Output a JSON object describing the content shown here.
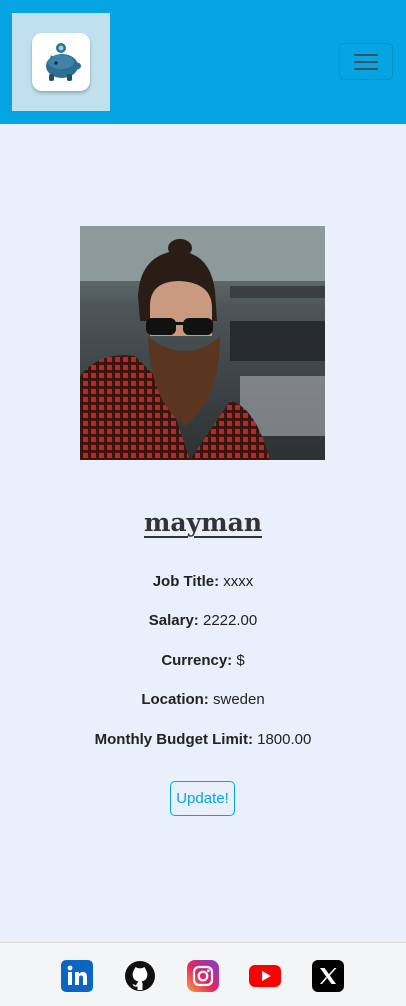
{
  "header": {
    "logo_icon": "piggy-bank-icon",
    "menu_icon": "hamburger-menu-icon"
  },
  "profile": {
    "photo_icon": "profile-photo",
    "username": "mayman",
    "fields": [
      {
        "label": "Job Title:",
        "value": "xxxx"
      },
      {
        "label": "Salary:",
        "value": "2222.00"
      },
      {
        "label": "Currency:",
        "value": "$"
      },
      {
        "label": "Location:",
        "value": "sweden"
      },
      {
        "label": "Monthly Budget Limit:",
        "value": "1800.00"
      }
    ],
    "update_label": "Update!"
  },
  "footer": {
    "social": [
      "linkedin-icon",
      "github-icon",
      "instagram-icon",
      "youtube-icon",
      "x-icon"
    ]
  },
  "colors": {
    "navbar": "#05a5e3",
    "page_background": "#e9f0fb",
    "accent": "#05a5e3",
    "footer_background": "#f4f5f6"
  }
}
